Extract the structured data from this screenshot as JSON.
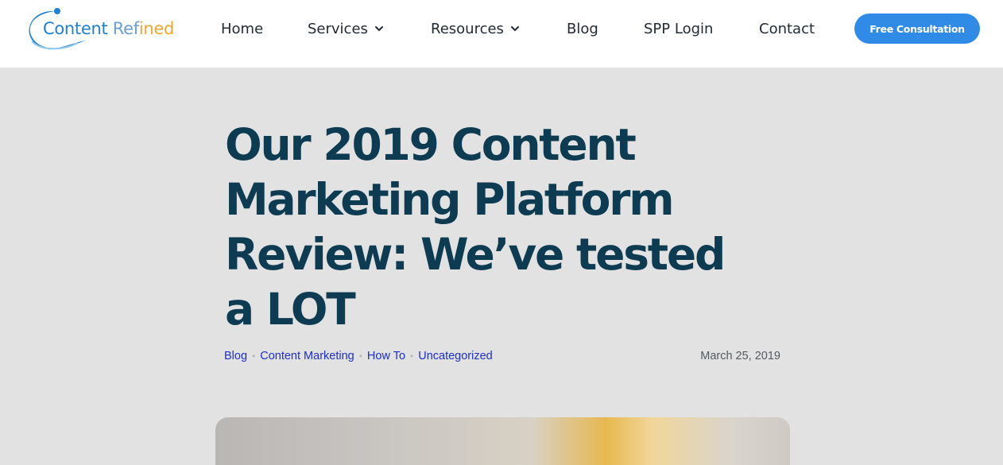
{
  "header": {
    "logo": {
      "part1": "Content ",
      "part2": "Ref",
      "part3": "ined"
    },
    "nav": [
      {
        "label": "Home"
      },
      {
        "label": "Services"
      },
      {
        "label": "Resources"
      },
      {
        "label": "Blog"
      },
      {
        "label": "SPP Login"
      },
      {
        "label": "Contact"
      }
    ],
    "cta_label": "Free Consultation"
  },
  "article": {
    "title": "Our 2019 Content Marketing Platform Review: We’ve tested a LOT",
    "categories": [
      "Blog",
      "Content Marketing",
      "How To",
      "Uncategorized"
    ],
    "date": "March 25, 2019"
  },
  "colors": {
    "accent": "#2f8be6",
    "title": "#0c3b52",
    "link": "#1b2ed4",
    "background": "#e2e2e2"
  },
  "icons": {
    "logo": "c-swirl-logo-icon",
    "dropdown": "chevron-down-icon"
  }
}
